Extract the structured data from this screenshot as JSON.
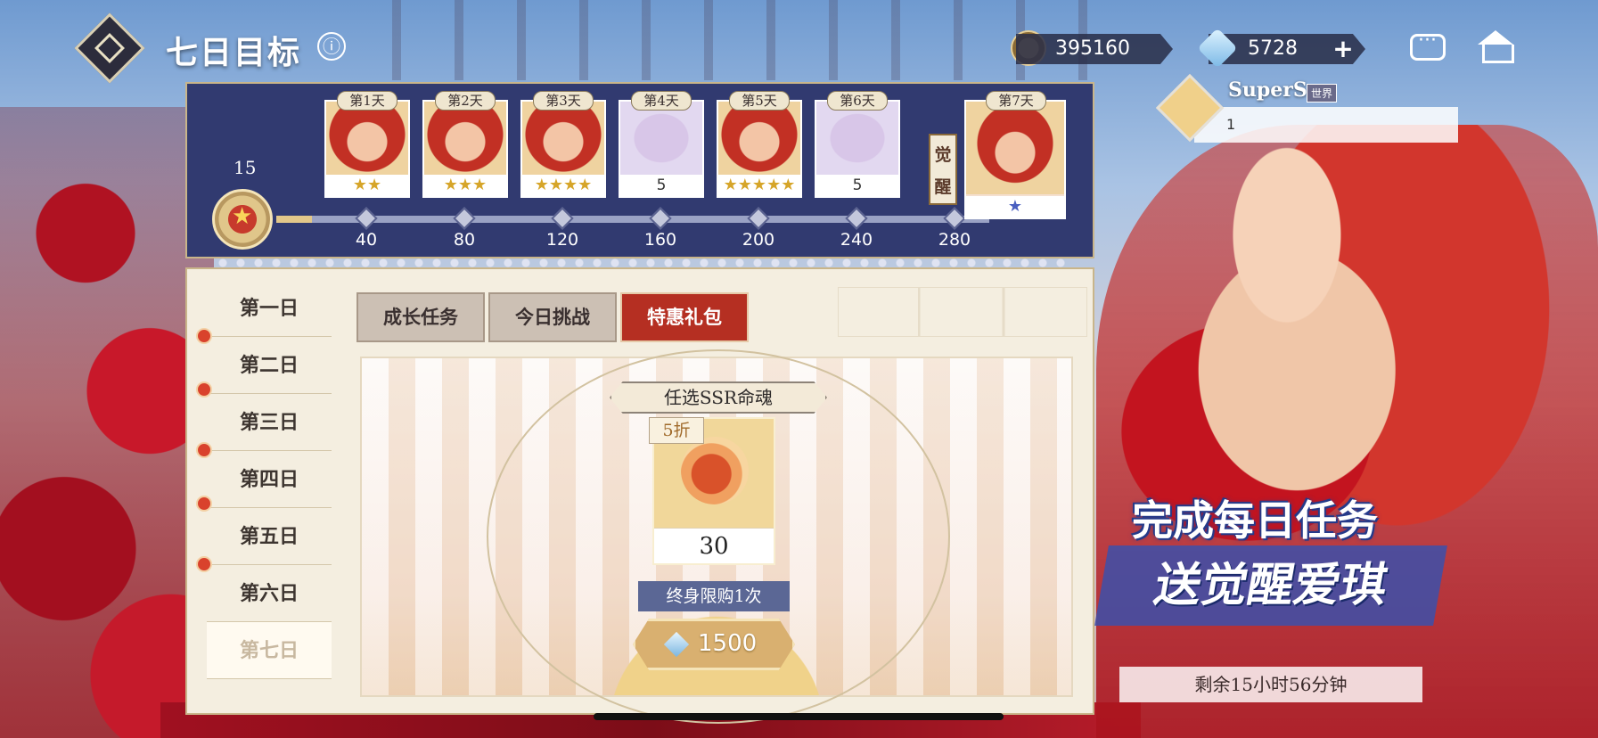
{
  "header": {
    "title": "七日目标",
    "info_icon": "ⓘ",
    "gold_amount": "395160",
    "gem_amount": "5728",
    "plus_label": "+"
  },
  "chat": {
    "player_name": "SuperS",
    "channel_badge": "世界",
    "message": "1"
  },
  "progress": {
    "current_points": "15",
    "milestones": [
      "40",
      "80",
      "120",
      "160",
      "200",
      "240",
      "280"
    ],
    "rewards": [
      {
        "day": "第1天",
        "value": "★★"
      },
      {
        "day": "第2天",
        "value": "★★★"
      },
      {
        "day": "第3天",
        "value": "★★★★"
      },
      {
        "day": "第4天",
        "value": "5"
      },
      {
        "day": "第5天",
        "value": "★★★★★"
      },
      {
        "day": "第6天",
        "value": "5"
      },
      {
        "day": "第7天",
        "value": "★"
      }
    ],
    "awaken_tag": "觉醒"
  },
  "days": [
    "第一日",
    "第二日",
    "第三日",
    "第四日",
    "第五日",
    "第六日",
    "第七日"
  ],
  "active_day_index": 6,
  "tabs": [
    "成长任务",
    "今日挑战",
    "特惠礼包"
  ],
  "active_tab_index": 2,
  "offer": {
    "title": "任选SSR命魂",
    "discount": "5折",
    "quantity": "30",
    "limit": "终身限购1次",
    "price": "1500"
  },
  "promo": {
    "line1": "完成每日任务",
    "line2": "送觉醒爱琪",
    "timer": "剩余15小时56分钟"
  },
  "colors": {
    "panel_blue": "#313a70",
    "active_tab_red": "#b52f22",
    "red_dot": "#d9422c"
  }
}
